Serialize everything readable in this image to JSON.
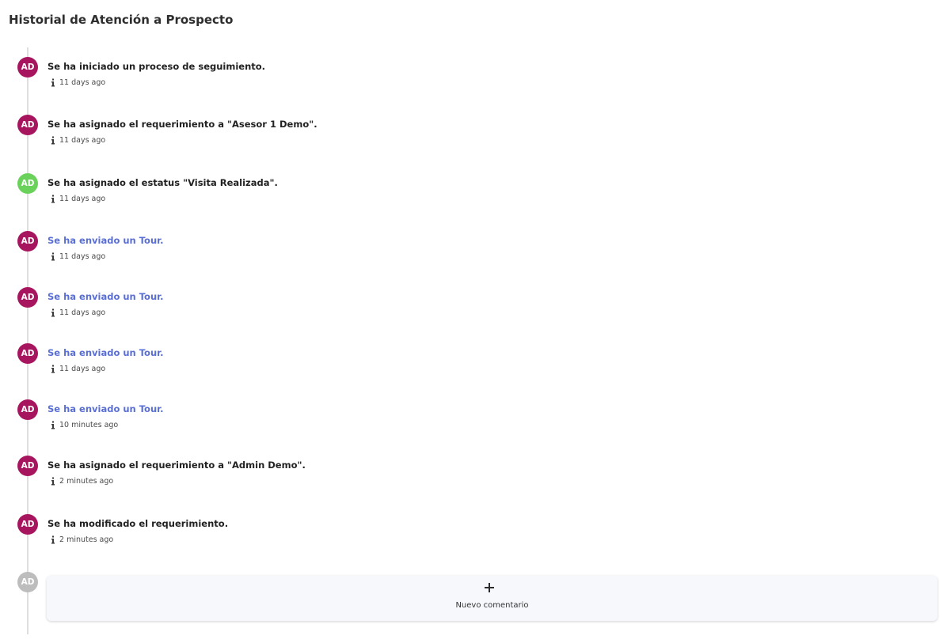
{
  "page": {
    "title": "Historial de Atención a Prospecto"
  },
  "colors": {
    "avatar_default": "#a8155f",
    "avatar_status": "#6ad15a",
    "avatar_disabled": "#bdbdbd",
    "link_text": "#5a6fd6",
    "timeline_line": "#dedede"
  },
  "timeline": {
    "entries": [
      {
        "initials": "AD",
        "text": "Se ha iniciado un proceso de seguimiento.",
        "time": "11 days ago",
        "avatar_color": "#a8155f",
        "is_link": false,
        "icon": "info-icon"
      },
      {
        "initials": "AD",
        "text": "Se ha asignado el requerimiento a \"Asesor 1 Demo\".",
        "time": "11 days ago",
        "avatar_color": "#a8155f",
        "is_link": false,
        "icon": "info-icon"
      },
      {
        "initials": "AD",
        "text": "Se ha asignado el estatus \"Visita Realizada\".",
        "time": "11 days ago",
        "avatar_color": "#6ad15a",
        "is_link": false,
        "icon": "info-icon"
      },
      {
        "initials": "AD",
        "text": "Se ha enviado un Tour.",
        "time": "11 days ago",
        "avatar_color": "#a8155f",
        "is_link": true,
        "icon": "info-icon"
      },
      {
        "initials": "AD",
        "text": "Se ha enviado un Tour.",
        "time": "11 days ago",
        "avatar_color": "#a8155f",
        "is_link": true,
        "icon": "info-icon"
      },
      {
        "initials": "AD",
        "text": "Se ha enviado un Tour.",
        "time": "11 days ago",
        "avatar_color": "#a8155f",
        "is_link": true,
        "icon": "info-icon"
      },
      {
        "initials": "AD",
        "text": "Se ha enviado un Tour.",
        "time": "10 minutes ago",
        "avatar_color": "#a8155f",
        "is_link": true,
        "icon": "info-icon"
      },
      {
        "initials": "AD",
        "text": "Se ha asignado el requerimiento a \"Admin Demo\".",
        "time": "2 minutes ago",
        "avatar_color": "#a8155f",
        "is_link": false,
        "icon": "info-icon"
      },
      {
        "initials": "AD",
        "text": "Se ha modificado el requerimiento.",
        "time": "2 minutes ago",
        "avatar_color": "#a8155f",
        "is_link": false,
        "icon": "info-icon"
      }
    ]
  },
  "new_comment": {
    "avatar_initials": "AD",
    "icon": "plus-icon",
    "label": "Nuevo comentario"
  }
}
